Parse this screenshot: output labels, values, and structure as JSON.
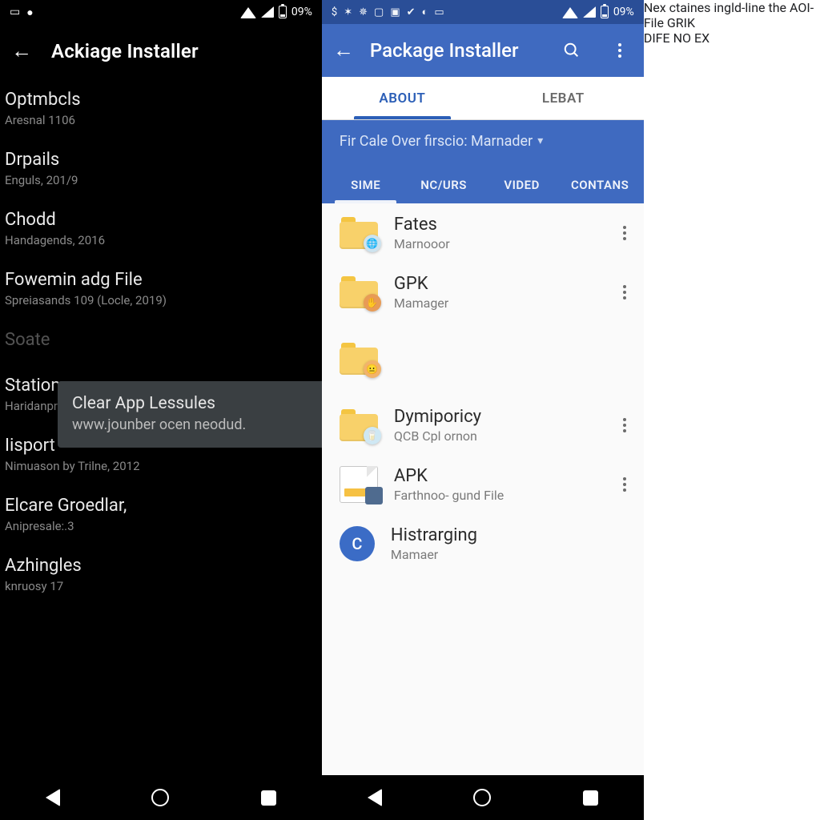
{
  "left": {
    "status": {
      "battery_text": "09%"
    },
    "appbar": {
      "title": "Ackiage Installer"
    },
    "rows": [
      {
        "primary": "Optmbcls",
        "secondary": "Aresnal 1106"
      },
      {
        "primary": "Drpails",
        "secondary": "Enguls, 201/9"
      },
      {
        "primary": "Chodd",
        "secondary": "Handagends, 2016"
      },
      {
        "primary": "Fowemin adg File",
        "secondary": "Spreiasands 109 (Locle, 2019)"
      },
      {
        "primary": "Soate",
        "secondary": ""
      },
      {
        "primary": "Stations",
        "secondary": "Haridanprles Flood"
      },
      {
        "primary": "Iisport",
        "secondary": "Nimuason by Trilne, 2012"
      },
      {
        "primary": "Elcare Groedlar,",
        "secondary": "Anipresale:.3"
      },
      {
        "primary": "Azhingles",
        "secondary": "knruosy 17"
      }
    ],
    "toast": {
      "line1": "Clear App Lessules",
      "line2": "www.jounber ocen neodud."
    }
  },
  "right": {
    "status": {
      "battery_text": "09%"
    },
    "appbar": {
      "title": "Package Installer"
    },
    "tabs_top": [
      {
        "label": "ABOUT",
        "active": true
      },
      {
        "label": "LEBAT",
        "active": false
      }
    ],
    "subheader": "Fir Cale Over firscio: Marnader",
    "tabs_sub": [
      {
        "label": "SIME",
        "active": true
      },
      {
        "label": "NC/URS",
        "active": false
      },
      {
        "label": "VIDED",
        "active": false
      },
      {
        "label": "CONTANS",
        "active": false
      }
    ],
    "files": [
      {
        "primary": "Fates",
        "secondary": "Marnooor",
        "icon": "folder",
        "badge": "globe"
      },
      {
        "primary": "GPK",
        "secondary": "Mamager",
        "icon": "folder",
        "badge": "hand"
      },
      {
        "primary": "",
        "secondary": "",
        "icon": "folder",
        "badge": "face"
      },
      {
        "primary": "Dymiporicy",
        "secondary": "QCB Cpl ornon",
        "icon": "folder",
        "badge": "cup"
      },
      {
        "primary": "APK",
        "secondary": "Farthnoo- gund File",
        "icon": "apk",
        "badge": ""
      },
      {
        "primary": "Histrarging",
        "secondary": "Mamaer",
        "icon": "circle",
        "badge": "C"
      }
    ],
    "dialog": {
      "message": "Nex ctaines ingld-line the AOI- File GRIK",
      "buttons": [
        "DIFE",
        "NO",
        "EX"
      ]
    }
  },
  "colors": {
    "primary_blue": "#3f6ac0",
    "accent_teal": "#3da0c9",
    "folder_yellow": "#f8d16a"
  }
}
